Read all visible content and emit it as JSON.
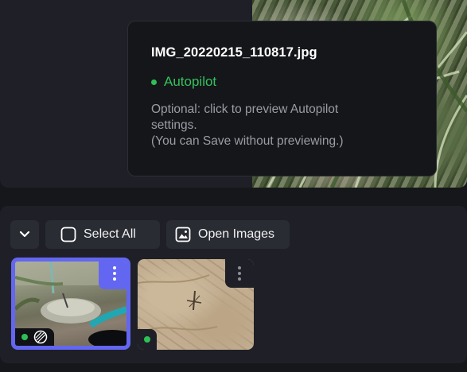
{
  "tooltip": {
    "filename": "IMG_20220215_110817.jpg",
    "status": "Autopilot",
    "description_line1": "Optional: click to preview Autopilot",
    "description_line2": "settings.",
    "description_line3": "(You can Save without previewing.)"
  },
  "toolbar": {
    "select_all_label": "Select All",
    "open_images_label": "Open Images"
  },
  "icons": {
    "collapse": "chevron-down-icon",
    "select_all": "checkbox-icon",
    "open_images": "image-icon",
    "menu": "kebab-menu-icon",
    "status": "green-dot-icon",
    "autopilot": "autopilot-badge-icon"
  },
  "colors": {
    "accent": "#6366f1",
    "status_green": "#34c15c",
    "panel": "#1f2027",
    "background": "#16171b"
  }
}
